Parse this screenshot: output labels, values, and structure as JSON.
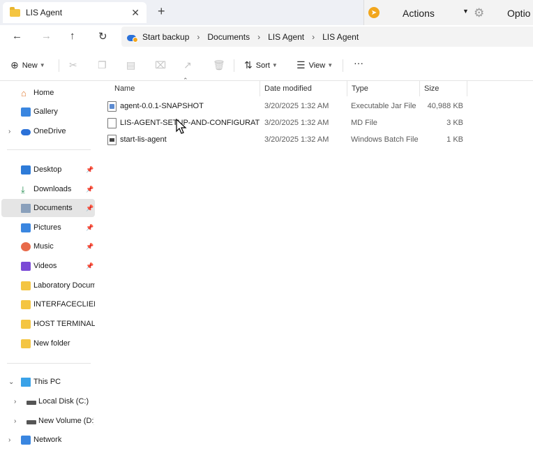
{
  "window": {
    "tab_title": "LIS Agent",
    "tab_close": "✕",
    "new_tab": "+"
  },
  "actions_panel": {
    "actions_label": "Actions",
    "options_label": "Optio"
  },
  "address": {
    "breadcrumbs": [
      "Start backup",
      "Documents",
      "LIS Agent",
      "LIS Agent"
    ]
  },
  "commandbar": {
    "new_label": "New",
    "sort_label": "Sort",
    "view_label": "View",
    "more_label": "···"
  },
  "nav": {
    "home": "Home",
    "gallery": "Gallery",
    "onedrive": "OneDrive",
    "desktop": "Desktop",
    "downloads": "Downloads",
    "documents": "Documents",
    "pictures": "Pictures",
    "music": "Music",
    "videos": "Videos",
    "laboratory": "Laboratory Docume",
    "interfaceclient": "INTERFACECLIENT_",
    "host_terminal": "HOST TERMINAL TC",
    "new_folder": "New folder",
    "this_pc": "This PC",
    "local_disk": "Local Disk (C:)",
    "new_volume": "New Volume (D:)",
    "network": "Network"
  },
  "columns": {
    "name": "Name",
    "date_modified": "Date modified",
    "type": "Type",
    "size": "Size"
  },
  "files": [
    {
      "name": "agent-0.0.1-SNAPSHOT",
      "date": "3/20/2025 1:32 AM",
      "type": "Executable Jar File",
      "size": "40,988 KB"
    },
    {
      "name": "LIS-AGENT-SETUP-AND-CONFIGURATIO...",
      "date": "3/20/2025 1:32 AM",
      "type": "MD File",
      "size": "3 KB"
    },
    {
      "name": "start-lis-agent",
      "date": "3/20/2025 1:32 AM",
      "type": "Windows Batch File",
      "size": "1 KB"
    }
  ]
}
